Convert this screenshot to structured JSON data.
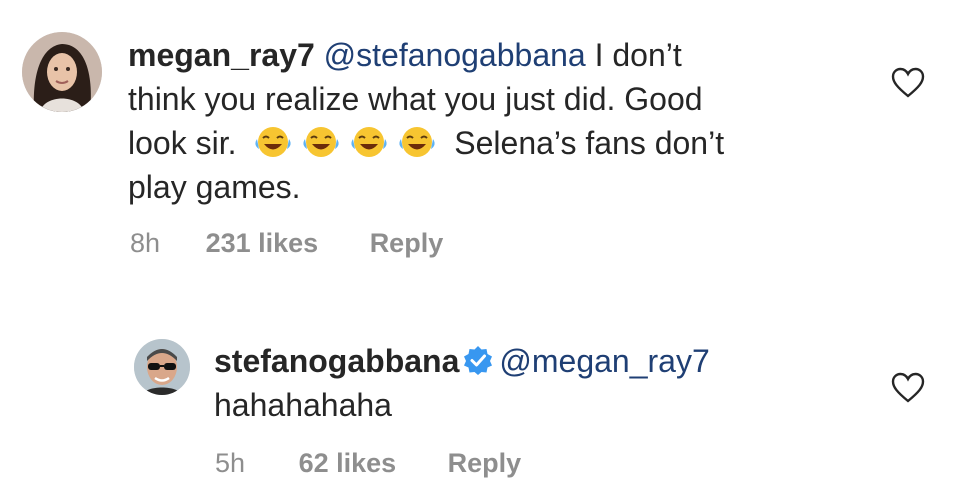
{
  "comments": [
    {
      "username": "megan_ray7",
      "mention": "@stefanogabbana",
      "text_line1": " I don’t",
      "text_line2": "think you realize what you just did. Good",
      "text_line3_before": "look sir.",
      "text_line3_after": "Selena’s fans don’t",
      "text_line4": "play games.",
      "emoji_name": "face-with-tears-of-joy",
      "emoji_count": 4,
      "time": "8h",
      "likes": "231 likes",
      "reply_label": "Reply",
      "avatar_icon": "avatar-woman-photo",
      "like_icon": "heart-outline-icon"
    },
    {
      "username": "stefanogabbana",
      "verified_icon": "verified-badge-icon",
      "mention": "@megan_ray7",
      "text_line2": "hahahahaha",
      "time": "5h",
      "likes": "62 likes",
      "reply_label": "Reply",
      "avatar_icon": "avatar-man-sunglasses-photo",
      "like_icon": "heart-outline-icon"
    }
  ],
  "colors": {
    "text": "#262626",
    "mention": "#1f3f74",
    "meta": "#8e8e8e",
    "verified": "#3897f0"
  }
}
